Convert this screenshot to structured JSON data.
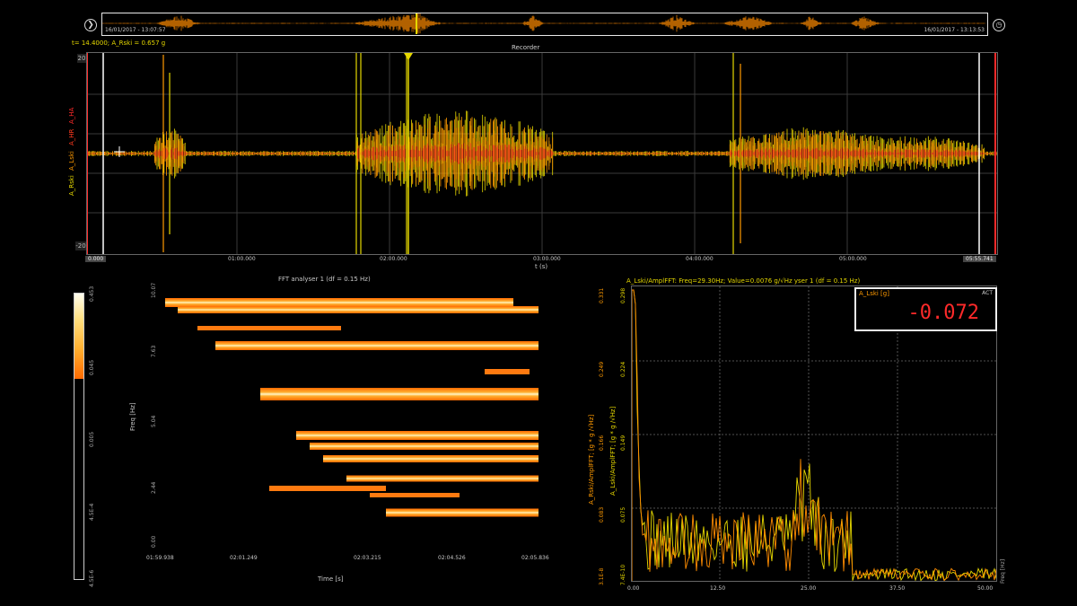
{
  "overview": {
    "start_time": "16/01/2017 - 13:07:57",
    "end_time": "16/01/2017 - 13:13:53",
    "play_icon": "play-circle-icon",
    "clock_icon": "clock-icon"
  },
  "recorder": {
    "title": "Recorder",
    "cursor_readout": "t= 14.4000; A_Rski = 0.657 g",
    "y_labels": [
      "A_Rski",
      "A_Lski",
      "A_HR",
      "A_HA"
    ],
    "y_label_colors": [
      "#e6d800",
      "#ff9a00",
      "#ff3b1f",
      "#ff2a2a"
    ],
    "ytick_top": "20",
    "ytick_bottom": "-20",
    "x_label": "t (s)",
    "x_start": "0.000",
    "x_end": "05:55.741",
    "x_ticks": [
      "01:00.000",
      "02:00.000",
      "03:00.000",
      "04:00.000",
      "05:00.000"
    ]
  },
  "fft_spectrogram": {
    "title": "FFT analyser 1 (df = 0.15 Hz)",
    "y_label": "Freq [Hz]",
    "y_ticks": [
      "10.07",
      "7.63",
      "5.04",
      "2.44",
      "0.00"
    ],
    "x_label": "Time [s]",
    "x_ticks": [
      "01:59.938",
      "02:01.249",
      "02:03.215",
      "02:04.526",
      "02:05.836"
    ],
    "colorbar_ticks": [
      "0.453",
      "0.045",
      "0.005",
      "4.5E-4",
      "4.5E-6"
    ]
  },
  "fft_spectrum": {
    "title": "A_Lski/AmplFFT: Freq=29.30Hz; Value=0.0076 g/√Hz  yser 1 (df = 0.15 Hz)",
    "y_label_outer": "A_Rski/AmplFFT; [g * g /√Hz]",
    "y_label_inner": "A_Lski/AmplFFT; [g * g /√Hz]",
    "y_ticks_outer": [
      "0.331",
      "0.249",
      "0.166",
      "0.083",
      "3.1E-8"
    ],
    "y_ticks_inner": [
      "0.298",
      "0.224",
      "0.149",
      "0.075",
      "7.4E-10"
    ],
    "x_ticks": [
      "0.00",
      "12.50",
      "25.00",
      "37.50",
      "50.00"
    ],
    "x_label": "Freq [Hz]",
    "display": {
      "label": "A_Lski [g]",
      "tag": "ACT",
      "value": "-0.072"
    },
    "series": [
      {
        "name": "A_Rski",
        "color": "#e6d800"
      },
      {
        "name": "A_Lski",
        "color": "#ff8c00"
      }
    ]
  },
  "chart_data": [
    {
      "type": "line",
      "title": "Recorder",
      "xlabel": "t (s)",
      "xlim": [
        0,
        355.741
      ],
      "ylim": [
        -20,
        20
      ],
      "series": [
        {
          "name": "A_Rski",
          "color": "#e6d800"
        },
        {
          "name": "A_Lski",
          "color": "#ff9a00"
        },
        {
          "name": "A_HR",
          "color": "#ff3b1f"
        },
        {
          "name": "A_HA",
          "color": "#ff2a2a"
        }
      ]
    },
    {
      "type": "heatmap",
      "title": "FFT analyser 1 (df = 0.15 Hz)",
      "xlabel": "Time [s]",
      "ylabel": "Freq [Hz]",
      "ylim": [
        0,
        10.07
      ],
      "bands_hz": [
        0.8,
        2.3,
        3.4,
        3.8,
        4.4,
        6.2,
        8.2,
        9.8
      ]
    },
    {
      "type": "line",
      "xlabel": "Freq [Hz]",
      "xlim": [
        0,
        50
      ],
      "series": [
        {
          "name": "A_Rski/AmplFFT",
          "peak_hz": 0.5,
          "peak_value": 0.331
        },
        {
          "name": "A_Lski/AmplFFT",
          "peak_hz": 0.5,
          "peak_value": 0.298
        }
      ]
    }
  ]
}
